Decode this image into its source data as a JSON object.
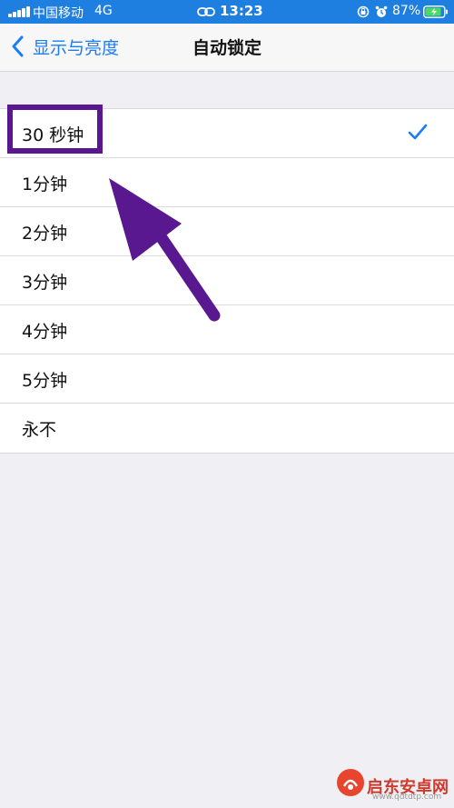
{
  "status_bar": {
    "carrier": "中国移动",
    "network": "4G",
    "time": "13:23",
    "battery": "87%",
    "bg_color": "#1e7fe0"
  },
  "nav": {
    "back_label": "显示与亮度",
    "title": "自动锁定",
    "accent": "#1a7cf6"
  },
  "options": [
    {
      "label": "30 秒钟",
      "selected": true
    },
    {
      "label": "1分钟",
      "selected": false
    },
    {
      "label": "2分钟",
      "selected": false
    },
    {
      "label": "3分钟",
      "selected": false
    },
    {
      "label": "4分钟",
      "selected": false
    },
    {
      "label": "5分钟",
      "selected": false
    },
    {
      "label": "永不",
      "selected": false
    }
  ],
  "annotation": {
    "color": "#5a1890"
  },
  "watermark": {
    "name": "启东安卓网",
    "url": "www.qdtdtp.com"
  }
}
